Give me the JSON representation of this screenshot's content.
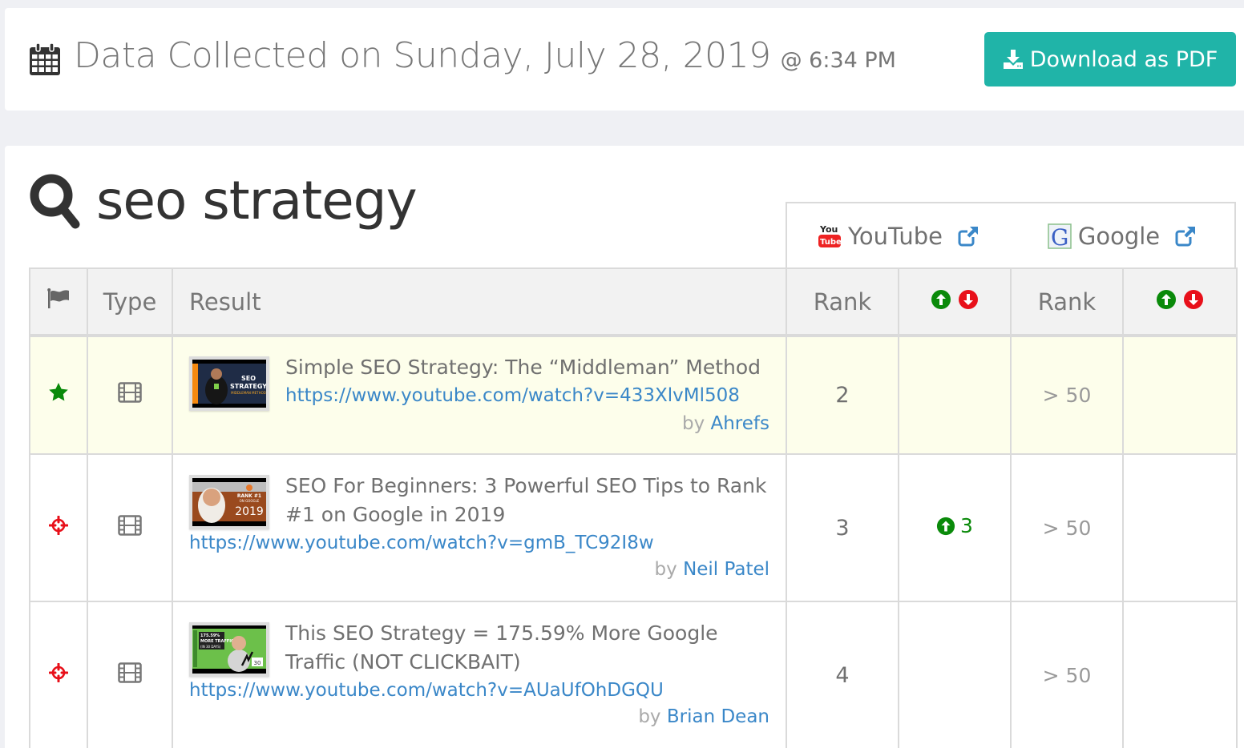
{
  "header": {
    "date_label": "Data Collected on Sunday, July 28, 2019",
    "time_label": "@ 6:34 PM",
    "download_button": "Download as PDF",
    "accent_color": "#20b4a8"
  },
  "query": {
    "text": "seo strategy"
  },
  "engines": [
    {
      "name": "YouTube",
      "icon": "youtube-logo-icon",
      "link_icon": "external-link-icon"
    },
    {
      "name": "Google",
      "icon": "google-logo-icon",
      "link_icon": "external-link-icon"
    }
  ],
  "table": {
    "columns": {
      "flag": "flag-icon",
      "type": "Type",
      "result": "Result",
      "youtube_rank": "Rank",
      "youtube_change": "up-down-arrows-icon",
      "google_rank": "Rank",
      "google_change": "up-down-arrows-icon"
    },
    "rows": [
      {
        "flag_icon": "star-icon",
        "type_icon": "film-icon",
        "title": "Simple SEO Strategy: The “Middleman” Method",
        "url": "https://www.youtube.com/watch?v=433XlvMl508",
        "by_label": "by",
        "author": "Ahrefs",
        "youtube_rank": "2",
        "youtube_change": "",
        "google_rank": "> 50",
        "google_change": "",
        "highlighted": true,
        "thumbnail_text": "SEO STRATEGY"
      },
      {
        "flag_icon": "crosshairs-icon",
        "type_icon": "film-icon",
        "title": "SEO For Beginners: 3 Powerful SEO Tips to Rank #1 on Google in 2019",
        "url": "https://www.youtube.com/watch?v=gmB_TC92I8w",
        "by_label": "by",
        "author": "Neil Patel",
        "youtube_rank": "3",
        "youtube_change": "3",
        "google_rank": "> 50",
        "google_change": "",
        "highlighted": false,
        "thumbnail_text": "RANK #1 2019"
      },
      {
        "flag_icon": "crosshairs-icon",
        "type_icon": "film-icon",
        "title": "This SEO Strategy = 175.59% More Google Traffic (NOT CLICKBAIT)",
        "url": "https://www.youtube.com/watch?v=AUaUfOhDGQU",
        "by_label": "by",
        "author": "Brian Dean",
        "youtube_rank": "4",
        "youtube_change": "",
        "google_rank": "> 50",
        "google_change": "",
        "highlighted": false,
        "thumbnail_text": "175.59% MORE TRAFFIC"
      }
    ]
  }
}
